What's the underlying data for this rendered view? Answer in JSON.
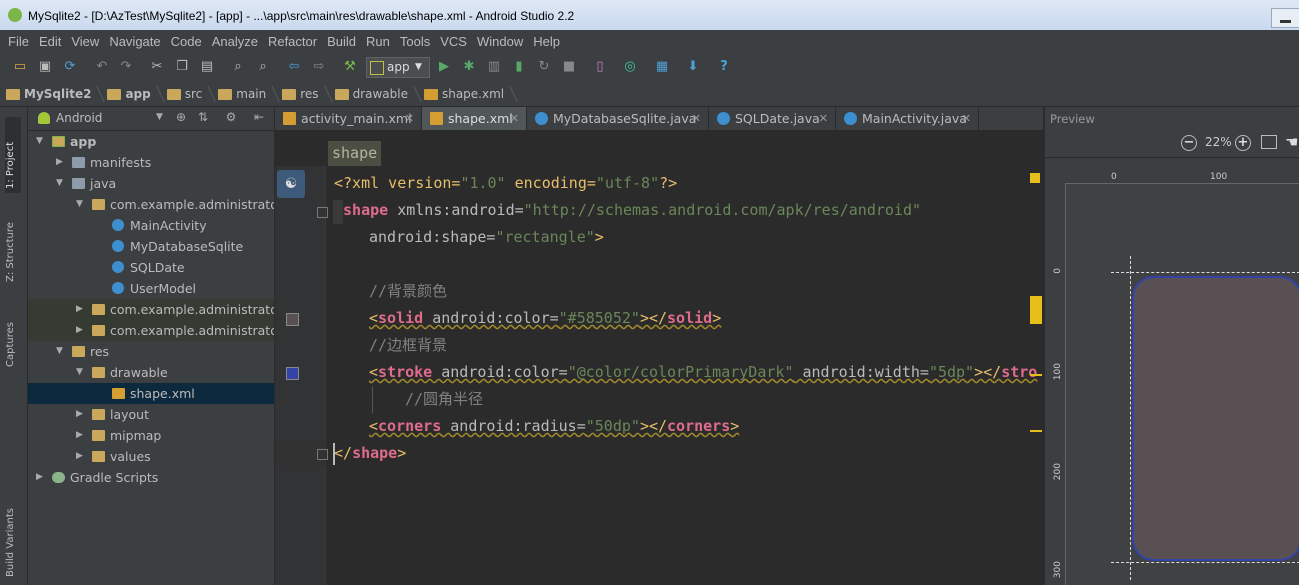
{
  "window": {
    "title": "MySqlite2 - [D:\\AzTest\\MySqlite2] - [app] - ...\\app\\src\\main\\res\\drawable\\shape.xml - Android Studio 2.2"
  },
  "menu": [
    "File",
    "Edit",
    "View",
    "Navigate",
    "Code",
    "Analyze",
    "Refactor",
    "Build",
    "Run",
    "Tools",
    "VCS",
    "Window",
    "Help"
  ],
  "toolbar": {
    "run_config": "app"
  },
  "breadcrumb": [
    "MySqlite2",
    "app",
    "src",
    "main",
    "res",
    "drawable",
    "shape.xml"
  ],
  "left_strip": {
    "project": "1: Project",
    "structure": "Z: Structure",
    "captures": "Captures",
    "build_variants": "Build Variants"
  },
  "project_panel": {
    "view_selector": "Android",
    "tree": [
      {
        "label": "app",
        "level": 0,
        "icon": "mod",
        "expanded": true,
        "bold": true
      },
      {
        "label": "manifests",
        "level": 1,
        "icon": "folder",
        "expanded": false
      },
      {
        "label": "java",
        "level": 1,
        "icon": "folder",
        "expanded": true
      },
      {
        "label": "com.example.administrator.m",
        "level": 2,
        "icon": "pkg",
        "expanded": true
      },
      {
        "label": "MainActivity",
        "level": 3,
        "icon": "cls"
      },
      {
        "label": "MyDatabaseSqlite",
        "level": 3,
        "icon": "cls"
      },
      {
        "label": "SQLDate",
        "level": 3,
        "icon": "cls"
      },
      {
        "label": "UserModel",
        "level": 3,
        "icon": "cls"
      },
      {
        "label": "com.example.administrator.m",
        "level": 2,
        "icon": "pkg",
        "expanded": false,
        "hl": true
      },
      {
        "label": "com.example.administrator.m",
        "level": 2,
        "icon": "pkg",
        "expanded": false,
        "hl": true
      },
      {
        "label": "res",
        "level": 1,
        "icon": "res",
        "expanded": true
      },
      {
        "label": "drawable",
        "level": 2,
        "icon": "pkg",
        "expanded": true
      },
      {
        "label": "shape.xml",
        "level": 3,
        "icon": "xml",
        "selected": true
      },
      {
        "label": "layout",
        "level": 2,
        "icon": "pkg",
        "expanded": false
      },
      {
        "label": "mipmap",
        "level": 2,
        "icon": "pkg",
        "expanded": false
      },
      {
        "label": "values",
        "level": 2,
        "icon": "pkg",
        "expanded": false
      },
      {
        "label": "Gradle Scripts",
        "level": 0,
        "icon": "gradle",
        "expanded": false
      }
    ]
  },
  "editor_tabs": [
    {
      "label": "activity_main.xml",
      "icon": "xml",
      "active": false
    },
    {
      "label": "shape.xml",
      "icon": "xml",
      "active": true
    },
    {
      "label": "MyDatabaseSqlite.java",
      "icon": "cls",
      "active": false
    },
    {
      "label": "SQLDate.java",
      "icon": "cls",
      "active": false
    },
    {
      "label": "MainActivity.java",
      "icon": "cls",
      "active": false
    }
  ],
  "editor": {
    "tag_breadcrumb": "shape",
    "lines": {
      "l1": {
        "a": "<?xml version=",
        "b": "\"1.0\"",
        "c": " encoding=",
        "d": "\"utf-8\"",
        "e": "?>"
      },
      "l2": {
        "a": "<",
        "b": "shape",
        "c": " xmlns:android=",
        "d": "\"http://schemas.android.com/apk/res/android\""
      },
      "l3": {
        "a": "android:shape=",
        "b": "\"rectangle\"",
        "c": ">"
      },
      "l5": "//背景颜色",
      "l6": {
        "a": "<",
        "b": "solid",
        "c": " android:color=",
        "d": "\"#585052\"",
        "e": "></",
        "f": "solid",
        "g": ">"
      },
      "l7": "//边框背景",
      "l8": {
        "a": "<",
        "b": "stroke",
        "c": " android:color=",
        "d": "\"@color/colorPrimaryDark\"",
        "e": " android:width=",
        "f": "\"5dp\"",
        "g": "></",
        "h": "stro"
      },
      "l9": "//圆角半径",
      "l10": {
        "a": "<",
        "b": "corners",
        "c": " android:radius=",
        "d": "\"50dp\"",
        "e": "></",
        "f": "corners",
        "g": ">"
      },
      "l11": {
        "a": "</",
        "b": "shape",
        "c": ">"
      }
    },
    "gutter_colors": {
      "solid": "#585052",
      "stroke": "#3443a8"
    }
  },
  "preview": {
    "title": "Preview",
    "zoom": "22%",
    "ruler_top": [
      "0",
      "100"
    ],
    "ruler_left": [
      "0",
      "100",
      "200",
      "300"
    ],
    "shape_fill": "#585052",
    "shape_stroke": "#3443a8"
  }
}
